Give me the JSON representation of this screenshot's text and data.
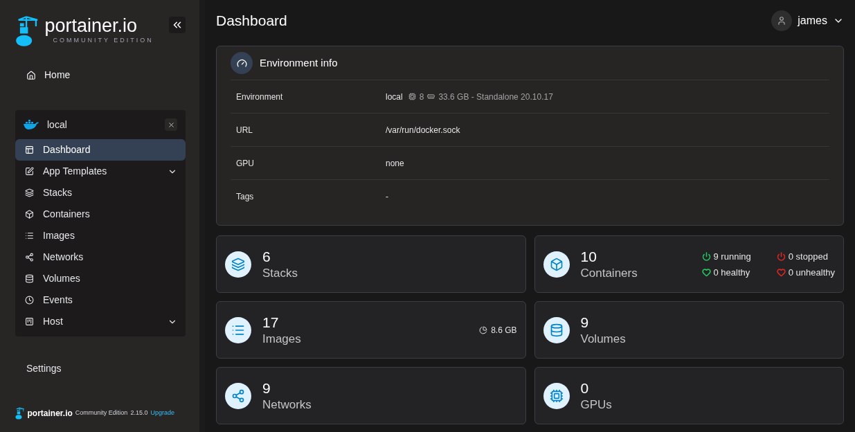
{
  "brand": {
    "name": "portainer.io",
    "edition": "COMMUNITY EDITION"
  },
  "sidebar": {
    "home": {
      "label": "Home"
    },
    "environment": {
      "name": "local"
    },
    "items": [
      {
        "label": "Dashboard",
        "selected": true,
        "expandable": false
      },
      {
        "label": "App Templates",
        "selected": false,
        "expandable": true
      },
      {
        "label": "Stacks",
        "selected": false,
        "expandable": false
      },
      {
        "label": "Containers",
        "selected": false,
        "expandable": false
      },
      {
        "label": "Images",
        "selected": false,
        "expandable": false
      },
      {
        "label": "Networks",
        "selected": false,
        "expandable": false
      },
      {
        "label": "Volumes",
        "selected": false,
        "expandable": false
      },
      {
        "label": "Events",
        "selected": false,
        "expandable": false
      },
      {
        "label": "Host",
        "selected": false,
        "expandable": true
      }
    ],
    "settings": "Settings",
    "footer": {
      "name": "portainer.io",
      "edition": "Community Edition",
      "version": "2.15.0",
      "link": "Upgrade"
    }
  },
  "header": {
    "title": "Dashboard",
    "user": "james"
  },
  "environment_info": {
    "title": "Environment info",
    "rows": [
      {
        "kind": "environment",
        "label": "Environment",
        "name": "local",
        "cpus": "8",
        "memory": "33.6 GB - Standalone 20.10.17"
      },
      {
        "kind": "text",
        "label": "URL",
        "value": "/var/run/docker.sock"
      },
      {
        "kind": "text",
        "label": "GPU",
        "value": "none"
      },
      {
        "kind": "text",
        "label": "Tags",
        "value": "-"
      }
    ]
  },
  "tiles": [
    {
      "count": "6",
      "label": "Stacks"
    },
    {
      "count": "10",
      "label": "Containers",
      "stats": [
        {
          "kind": "power",
          "text": "9 running",
          "color": "#22c55e"
        },
        {
          "kind": "power",
          "text": "0 stopped",
          "color": "#dc2626"
        },
        {
          "kind": "heart",
          "text": "0 healthy",
          "color": "#22c55e"
        },
        {
          "kind": "heart",
          "text": "0 unhealthy",
          "color": "#dc2626"
        }
      ]
    },
    {
      "count": "17",
      "label": "Images",
      "size": "8.6 GB"
    },
    {
      "count": "9",
      "label": "Volumes"
    },
    {
      "count": "9",
      "label": "Networks"
    },
    {
      "count": "0",
      "label": "GPUs"
    }
  ]
}
